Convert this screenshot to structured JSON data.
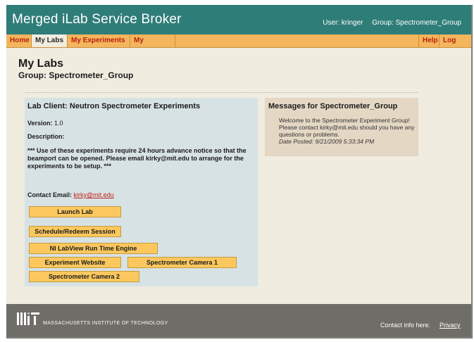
{
  "header": {
    "app_title": "Merged iLab Service Broker",
    "user_label": "User: kringer",
    "group_label": "Group: Spectrometer_Group"
  },
  "nav": {
    "home": "Home",
    "my_labs": "My Labs",
    "my_experiments": "My Experiments",
    "my_account": "My Account",
    "help": "Help",
    "log_out": "Log out",
    "active": "My Labs"
  },
  "page": {
    "title": "My Labs",
    "group": "Group: Spectrometer_Group"
  },
  "lab_client": {
    "title": "Lab Client: Neutron Spectrometer Experiments",
    "version_label": "Version:",
    "version_value": "1.0",
    "description_label": "Description:",
    "description_text": "*** Use of these experiments require 24 hours advance notice so that the beamport can be opened. Please email kirky@mit.edu to arrange for the experiments to be setup. ***",
    "contact_label": "Contact Email:",
    "contact_email": "kirky@mit.edu",
    "buttons": {
      "launch_lab": "Launch Lab",
      "schedule_redeem": "Schedule/Redeem Session",
      "labview_runtime": "NI LabView Run Time Engine",
      "experiment_website": "Experiment Website",
      "spectrometer_camera_1": "Spectrometer Camera 1",
      "spectrometer_camera_2": "Spectrometer Camera 2"
    }
  },
  "messages": {
    "title": "Messages for Spectrometer_Group",
    "body": "Welcome to the Spectrometer Experiment Group! Please contact kirky@mit.edu should you have any questions or problems.",
    "date_posted": "Date Posted: 9/21/2009 5:33:34 PM"
  },
  "footer": {
    "institute_name": "MASSACHUSETTS INSTITUTE OF TECHNOLOGY",
    "contact_info": "Contact info here.",
    "privacy": "Privacy"
  },
  "colors": {
    "header_bg": "#2f7d78",
    "nav_bg": "#f4b55c",
    "nav_text": "#b52310",
    "content_bg": "#f0ece0",
    "lab_panel_bg": "#d7e2e4",
    "message_panel_bg": "#e4d7c4",
    "button_bg": "#fcc85e",
    "footer_bg": "#6f6d67"
  }
}
